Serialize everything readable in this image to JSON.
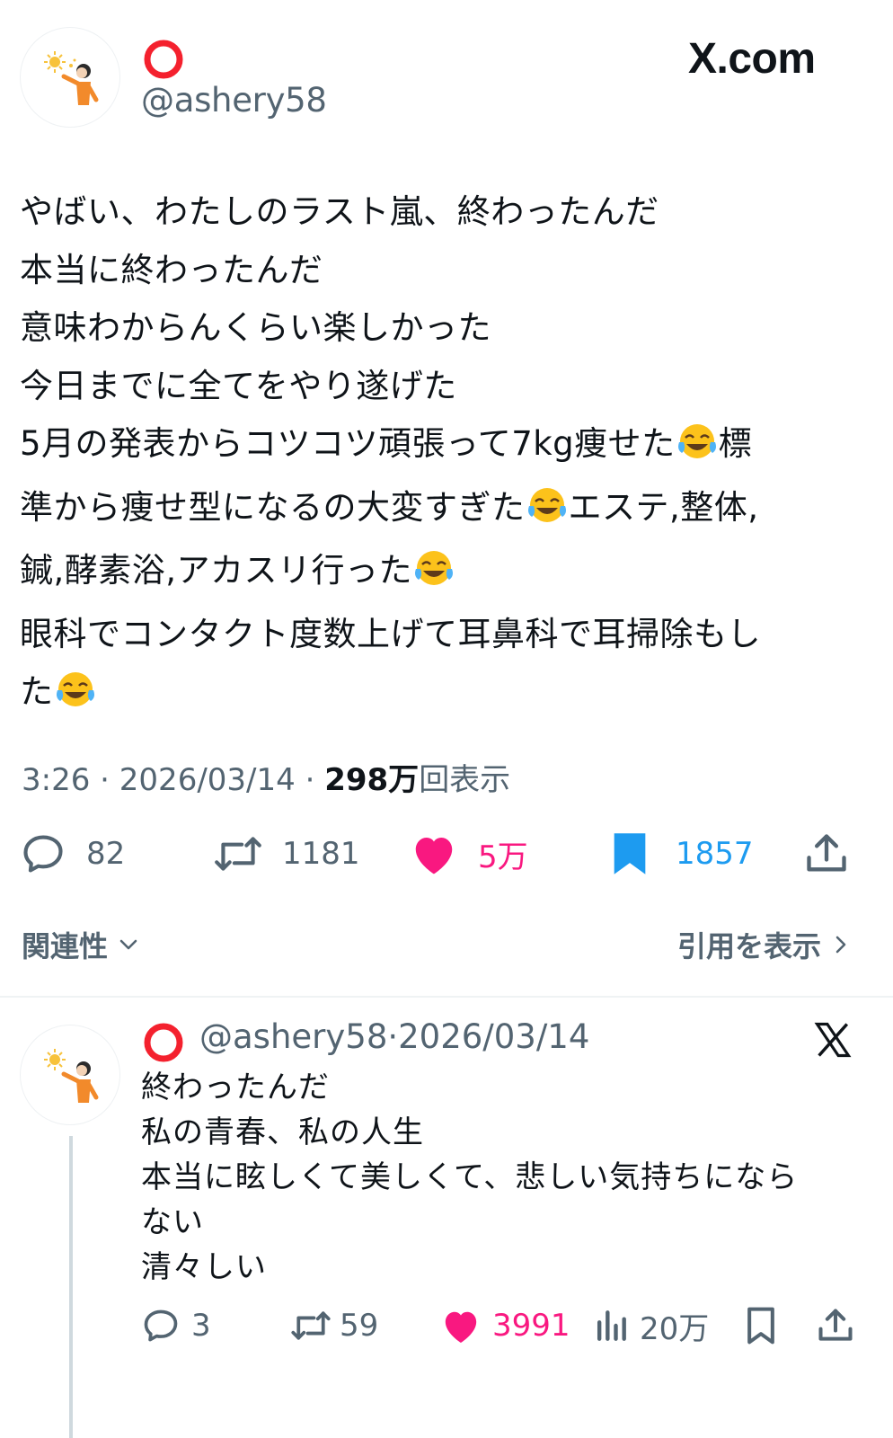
{
  "site": {
    "badge": "X.com"
  },
  "tweet": {
    "handle": "@ashery58",
    "lines": [
      "やばい、わたしのラスト嵐、終わったんだ",
      "本当に終わったんだ",
      "意味わからんくらい楽しかった",
      "今日までに全てをやり遂げた",
      "5月の発表からコツコツ頑張って7kg痩せた",
      "標",
      "準から痩せ型になるの大変すぎた",
      "エステ,整体,",
      "鍼,酵素浴,アカスリ行った",
      "眼科でコンタクト度数上げて耳鼻科で耳掃除もし",
      "た"
    ],
    "time": "3:26",
    "date": "2026/03/14",
    "views_count": "298万",
    "views_label": "回表示",
    "stats": {
      "replies": "82",
      "retweets": "1181",
      "likes": "5万",
      "bookmarks": "1857"
    }
  },
  "sort": {
    "label": "関連性"
  },
  "quotes": {
    "label": "引用を表示"
  },
  "reply": {
    "handle": "@ashery58",
    "date": "2026/03/14",
    "lines": [
      "終わったんだ",
      "私の青春、私の人生",
      "本当に眩しくて美しくて、悲しい気持ちになら",
      "ない",
      "清々しい"
    ],
    "stats": {
      "replies": "3",
      "retweets": "59",
      "likes": "3991",
      "views": "20万"
    }
  },
  "colors": {
    "like": "#f91880",
    "bookmark": "#1d9bf0",
    "ring": "#f4212e",
    "secondary": "#536471"
  },
  "icons": [
    "reply-icon",
    "retweet-icon",
    "heart-icon",
    "bookmark-icon",
    "share-icon",
    "views-icon",
    "chevron-down-icon",
    "chevron-right-icon",
    "x-logo-icon",
    "sun-icon"
  ]
}
